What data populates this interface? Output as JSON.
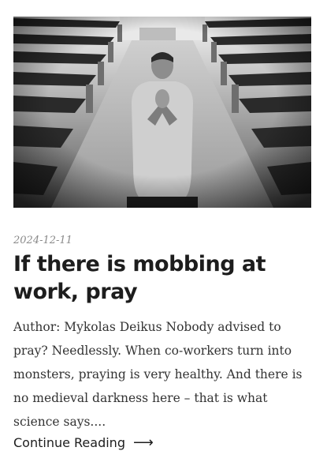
{
  "post": {
    "image_alt": "Man kneeling in a church aisle praying",
    "date": "2024-12-11",
    "title": "If there is mobbing at work, pray",
    "excerpt": "Author: Mykolas Deikus Nobody advised to pray? Needlessly. When co-workers turn into monsters, praying is very healthy. And there is no medieval darkness here – that is what science says....",
    "read_more_label": "Continue Reading",
    "read_more_icon": "arrow-right-icon"
  },
  "colors": {
    "title": "#1d1d1d",
    "date": "#8a8a8a",
    "text": "#333333"
  }
}
